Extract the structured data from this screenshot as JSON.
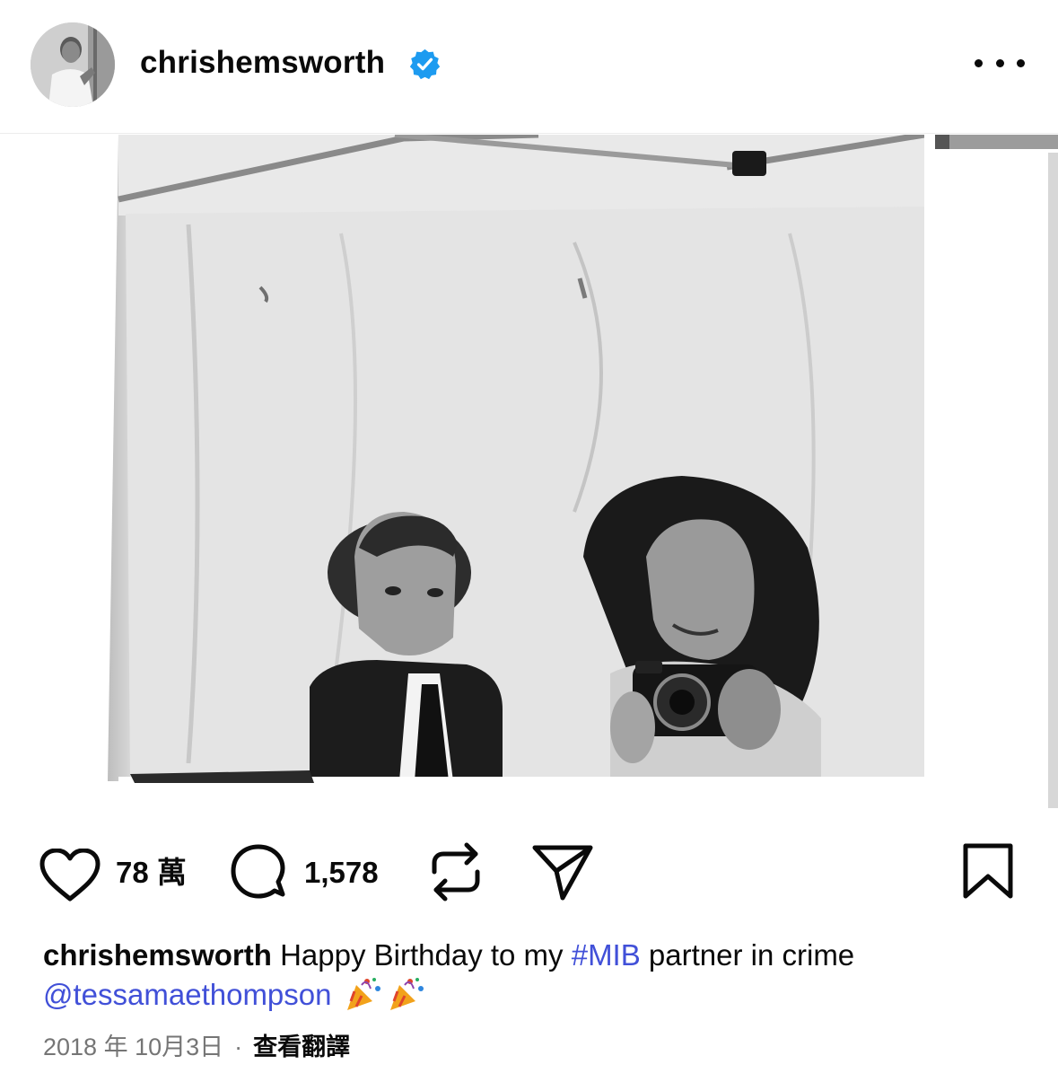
{
  "post": {
    "username": "chrishemsworth",
    "verified": true,
    "menu_icon": "more-horizontal-icon",
    "photo_alt": "black-and-white photo"
  },
  "actions": {
    "like_icon": "heart-icon",
    "like_count": "78 萬",
    "comment_icon": "comment-icon",
    "comment_count": "1,578",
    "repost_icon": "repost-icon",
    "share_icon": "send-icon",
    "save_icon": "bookmark-icon"
  },
  "caption": {
    "username": "chrishemsworth",
    "text_1": " Happy Birthday to my ",
    "hashtag": "#MIB",
    "text_2": " partner in crime",
    "mention": "@tessamaethompson",
    "emoji": "party-popper-emoji"
  },
  "meta": {
    "date": "2018 年 10月3日",
    "separator": "·",
    "translate_label": "查看翻譯"
  },
  "colors": {
    "text": "#0a0a0a",
    "link": "#4150d8",
    "verified": "#1d9bf0",
    "muted": "#757575"
  }
}
